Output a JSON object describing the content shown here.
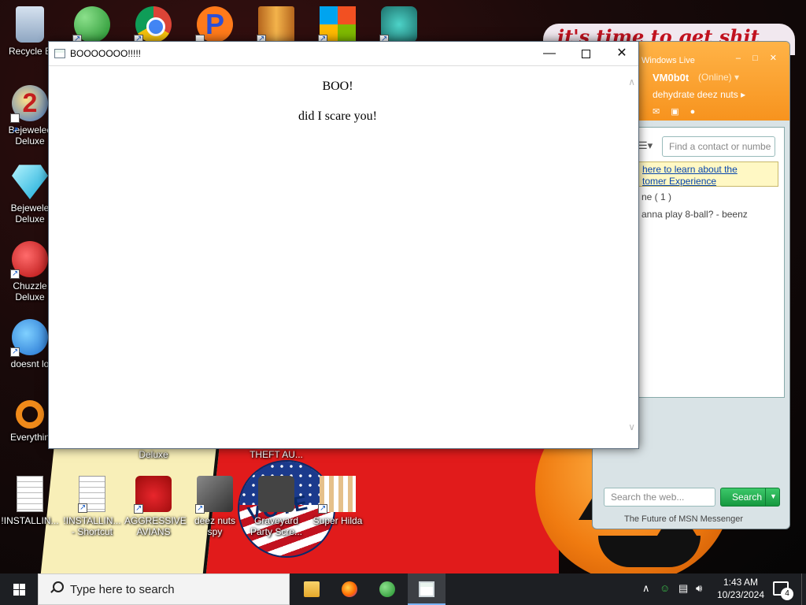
{
  "wallpaper": {
    "banner_text": "it's time to get shit"
  },
  "desktop_icons": [
    {
      "id": "recycle-bin",
      "label": "Recycle B",
      "icon": "recycle-bin-icon"
    },
    {
      "id": "bejeweled2",
      "label": "Bejewelec Deluxe",
      "icon": "bejeweled-2-icon"
    },
    {
      "id": "bejeweled",
      "label": "Bejewele Deluxe",
      "icon": "bejeweled-gem-icon"
    },
    {
      "id": "chuzzle",
      "label": "Chuzzle Deluxe",
      "icon": "chuzzle-icon"
    },
    {
      "id": "thunderbird",
      "label": "doesnt lo",
      "icon": "thunderbird-icon"
    },
    {
      "id": "everything",
      "label": "Everythin",
      "icon": "everything-search-icon"
    },
    {
      "id": "installing",
      "label": "!INSTALLIN...",
      "icon": "text-document-icon"
    },
    {
      "id": "installing-shortcut",
      "label": "!INSTALLIN... - Shortcut",
      "icon": "text-document-icon"
    },
    {
      "id": "aggressive-avians",
      "label": "AGGRESSIVE AVIANS",
      "icon": "angry-bird-icon"
    },
    {
      "id": "deez-nuts-spy",
      "label": "deez nuts spy",
      "icon": "windows-stack-icon"
    },
    {
      "id": "graveyard",
      "label": "Graveyard Party Scre...",
      "icon": "graveyard-icon"
    },
    {
      "id": "super-hilda",
      "label": "Super Hilda",
      "icon": "pixel-dog-icon"
    },
    {
      "id": "hidden-deluxe",
      "label": "Deluxe",
      "icon": ""
    },
    {
      "id": "hidden-theft",
      "label": "THEFT AU...",
      "icon": ""
    },
    {
      "id": "top-msn",
      "label": "",
      "icon": "msn-people-icon"
    },
    {
      "id": "top-chrome",
      "label": "",
      "icon": "chrome-icon"
    },
    {
      "id": "top-p",
      "label": "",
      "icon": "p-app-icon"
    },
    {
      "id": "top-book",
      "label": "",
      "icon": "book-app-icon"
    },
    {
      "id": "top-win",
      "label": "",
      "icon": "windows-logo-icon"
    },
    {
      "id": "top-game",
      "label": "",
      "icon": "game-character-icon"
    }
  ],
  "msn": {
    "window_title": "Windows Live",
    "username": "VM0b0t",
    "status": "(Online) ▾",
    "personal_message": "dehydrate deez nuts ▸",
    "find_placeholder": "Find a contact or numbe",
    "ad_line1": "here to learn about the",
    "ad_line2": "tomer Experience",
    "group_label": "ne ( 1 )",
    "contact_line": "anna play 8-ball? - beenz",
    "search_placeholder": "Search the web...",
    "search_button": "Search",
    "footer": "The Future of MSN Messenger"
  },
  "dialog": {
    "title": "BOOOOOOO!!!!!",
    "heading": "BOO!",
    "body": "did I scare you!"
  },
  "taskbar": {
    "search_placeholder": "Type here to search",
    "apps": [
      "file-explorer",
      "firefox",
      "msn-messenger",
      "boo-dialog"
    ],
    "time": "1:43 AM",
    "date": "10/23/2024",
    "notification_count": "4"
  }
}
